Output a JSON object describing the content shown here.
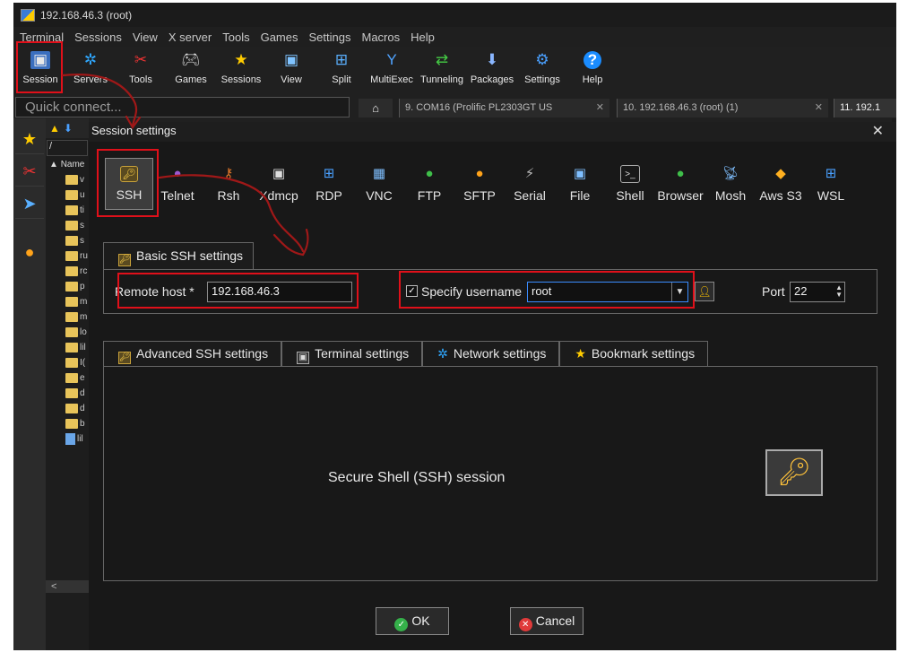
{
  "window": {
    "title": "192.168.46.3 (root)"
  },
  "menu": [
    "Terminal",
    "Sessions",
    "View",
    "X server",
    "Tools",
    "Games",
    "Settings",
    "Macros",
    "Help"
  ],
  "toolbar": {
    "buttons": [
      {
        "label": "Session",
        "icon": "session-icon"
      },
      {
        "label": "Servers",
        "icon": "servers-icon"
      },
      {
        "label": "Tools",
        "icon": "tools-icon"
      },
      {
        "label": "Games",
        "icon": "games-icon"
      },
      {
        "label": "Sessions",
        "icon": "sessions-star-icon"
      },
      {
        "label": "View",
        "icon": "view-icon"
      },
      {
        "label": "Split",
        "icon": "split-icon"
      },
      {
        "label": "MultiExec",
        "icon": "multiexec-icon"
      },
      {
        "label": "Tunneling",
        "icon": "tunneling-icon"
      },
      {
        "label": "Packages",
        "icon": "packages-icon"
      },
      {
        "label": "Settings",
        "icon": "settings-icon"
      },
      {
        "label": "Help",
        "icon": "help-icon"
      }
    ]
  },
  "quick_connect": {
    "placeholder": "Quick connect..."
  },
  "tabs": [
    {
      "label": "9. COM16  (Prolific PL2303GT US"
    },
    {
      "label": "10. 192.168.46.3 (root) (1)"
    },
    {
      "label": "11. 192.1"
    }
  ],
  "file_pane": {
    "path": "/",
    "header": "Name",
    "rows": [
      "v",
      "u",
      "ti",
      "s",
      "s",
      "ru",
      "rc",
      "p",
      "m",
      "m",
      "lo",
      "lil",
      "I(",
      "e",
      "d",
      "d",
      "b",
      "lil"
    ]
  },
  "dialog": {
    "title": "Session settings",
    "session_types": [
      "SSH",
      "Telnet",
      "Rsh",
      "Xdmcp",
      "RDP",
      "VNC",
      "FTP",
      "SFTP",
      "Serial",
      "File",
      "Shell",
      "Browser",
      "Mosh",
      "Aws S3",
      "WSL"
    ],
    "basic_tab_label": "Basic SSH settings",
    "remote_host_label": "Remote host *",
    "remote_host_value": "192.168.46.3",
    "specify_username_label": "Specify username",
    "specify_username_checked": true,
    "username_value": "root",
    "port_label": "Port",
    "port_value": "22",
    "settings_tabs": [
      "Advanced SSH settings",
      "Terminal settings",
      "Network settings",
      "Bookmark settings"
    ],
    "description": "Secure Shell (SSH) session",
    "ok_label": "OK",
    "cancel_label": "Cancel"
  },
  "colors": {
    "annotation_red": "#e0101a",
    "accent_yellow": "#ffc23a"
  }
}
